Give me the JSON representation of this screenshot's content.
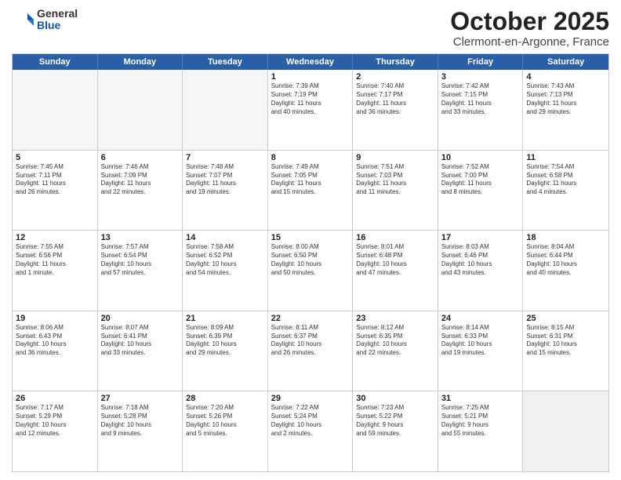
{
  "logo": {
    "general": "General",
    "blue": "Blue"
  },
  "title": "October 2025",
  "location": "Clermont-en-Argonne, France",
  "headers": [
    "Sunday",
    "Monday",
    "Tuesday",
    "Wednesday",
    "Thursday",
    "Friday",
    "Saturday"
  ],
  "rows": [
    [
      {
        "day": "",
        "text": "",
        "empty": true
      },
      {
        "day": "",
        "text": "",
        "empty": true
      },
      {
        "day": "",
        "text": "",
        "empty": true
      },
      {
        "day": "1",
        "text": "Sunrise: 7:39 AM\nSunset: 7:19 PM\nDaylight: 11 hours\nand 40 minutes."
      },
      {
        "day": "2",
        "text": "Sunrise: 7:40 AM\nSunset: 7:17 PM\nDaylight: 11 hours\nand 36 minutes."
      },
      {
        "day": "3",
        "text": "Sunrise: 7:42 AM\nSunset: 7:15 PM\nDaylight: 11 hours\nand 33 minutes."
      },
      {
        "day": "4",
        "text": "Sunrise: 7:43 AM\nSunset: 7:13 PM\nDaylight: 11 hours\nand 29 minutes."
      }
    ],
    [
      {
        "day": "5",
        "text": "Sunrise: 7:45 AM\nSunset: 7:11 PM\nDaylight: 11 hours\nand 26 minutes."
      },
      {
        "day": "6",
        "text": "Sunrise: 7:46 AM\nSunset: 7:09 PM\nDaylight: 11 hours\nand 22 minutes."
      },
      {
        "day": "7",
        "text": "Sunrise: 7:48 AM\nSunset: 7:07 PM\nDaylight: 11 hours\nand 19 minutes."
      },
      {
        "day": "8",
        "text": "Sunrise: 7:49 AM\nSunset: 7:05 PM\nDaylight: 11 hours\nand 15 minutes."
      },
      {
        "day": "9",
        "text": "Sunrise: 7:51 AM\nSunset: 7:03 PM\nDaylight: 11 hours\nand 11 minutes."
      },
      {
        "day": "10",
        "text": "Sunrise: 7:52 AM\nSunset: 7:00 PM\nDaylight: 11 hours\nand 8 minutes."
      },
      {
        "day": "11",
        "text": "Sunrise: 7:54 AM\nSunset: 6:58 PM\nDaylight: 11 hours\nand 4 minutes."
      }
    ],
    [
      {
        "day": "12",
        "text": "Sunrise: 7:55 AM\nSunset: 6:56 PM\nDaylight: 11 hours\nand 1 minute."
      },
      {
        "day": "13",
        "text": "Sunrise: 7:57 AM\nSunset: 6:54 PM\nDaylight: 10 hours\nand 57 minutes."
      },
      {
        "day": "14",
        "text": "Sunrise: 7:58 AM\nSunset: 6:52 PM\nDaylight: 10 hours\nand 54 minutes."
      },
      {
        "day": "15",
        "text": "Sunrise: 8:00 AM\nSunset: 6:50 PM\nDaylight: 10 hours\nand 50 minutes."
      },
      {
        "day": "16",
        "text": "Sunrise: 8:01 AM\nSunset: 6:48 PM\nDaylight: 10 hours\nand 47 minutes."
      },
      {
        "day": "17",
        "text": "Sunrise: 8:03 AM\nSunset: 6:46 PM\nDaylight: 10 hours\nand 43 minutes."
      },
      {
        "day": "18",
        "text": "Sunrise: 8:04 AM\nSunset: 6:44 PM\nDaylight: 10 hours\nand 40 minutes."
      }
    ],
    [
      {
        "day": "19",
        "text": "Sunrise: 8:06 AM\nSunset: 6:43 PM\nDaylight: 10 hours\nand 36 minutes."
      },
      {
        "day": "20",
        "text": "Sunrise: 8:07 AM\nSunset: 6:41 PM\nDaylight: 10 hours\nand 33 minutes."
      },
      {
        "day": "21",
        "text": "Sunrise: 8:09 AM\nSunset: 6:39 PM\nDaylight: 10 hours\nand 29 minutes."
      },
      {
        "day": "22",
        "text": "Sunrise: 8:11 AM\nSunset: 6:37 PM\nDaylight: 10 hours\nand 26 minutes."
      },
      {
        "day": "23",
        "text": "Sunrise: 8:12 AM\nSunset: 6:35 PM\nDaylight: 10 hours\nand 22 minutes."
      },
      {
        "day": "24",
        "text": "Sunrise: 8:14 AM\nSunset: 6:33 PM\nDaylight: 10 hours\nand 19 minutes."
      },
      {
        "day": "25",
        "text": "Sunrise: 8:15 AM\nSunset: 6:31 PM\nDaylight: 10 hours\nand 15 minutes."
      }
    ],
    [
      {
        "day": "26",
        "text": "Sunrise: 7:17 AM\nSunset: 5:29 PM\nDaylight: 10 hours\nand 12 minutes."
      },
      {
        "day": "27",
        "text": "Sunrise: 7:18 AM\nSunset: 5:28 PM\nDaylight: 10 hours\nand 9 minutes."
      },
      {
        "day": "28",
        "text": "Sunrise: 7:20 AM\nSunset: 5:26 PM\nDaylight: 10 hours\nand 5 minutes."
      },
      {
        "day": "29",
        "text": "Sunrise: 7:22 AM\nSunset: 5:24 PM\nDaylight: 10 hours\nand 2 minutes."
      },
      {
        "day": "30",
        "text": "Sunrise: 7:23 AM\nSunset: 5:22 PM\nDaylight: 9 hours\nand 59 minutes."
      },
      {
        "day": "31",
        "text": "Sunrise: 7:25 AM\nSunset: 5:21 PM\nDaylight: 9 hours\nand 55 minutes."
      },
      {
        "day": "",
        "text": "",
        "empty": true,
        "shaded": true
      }
    ]
  ]
}
